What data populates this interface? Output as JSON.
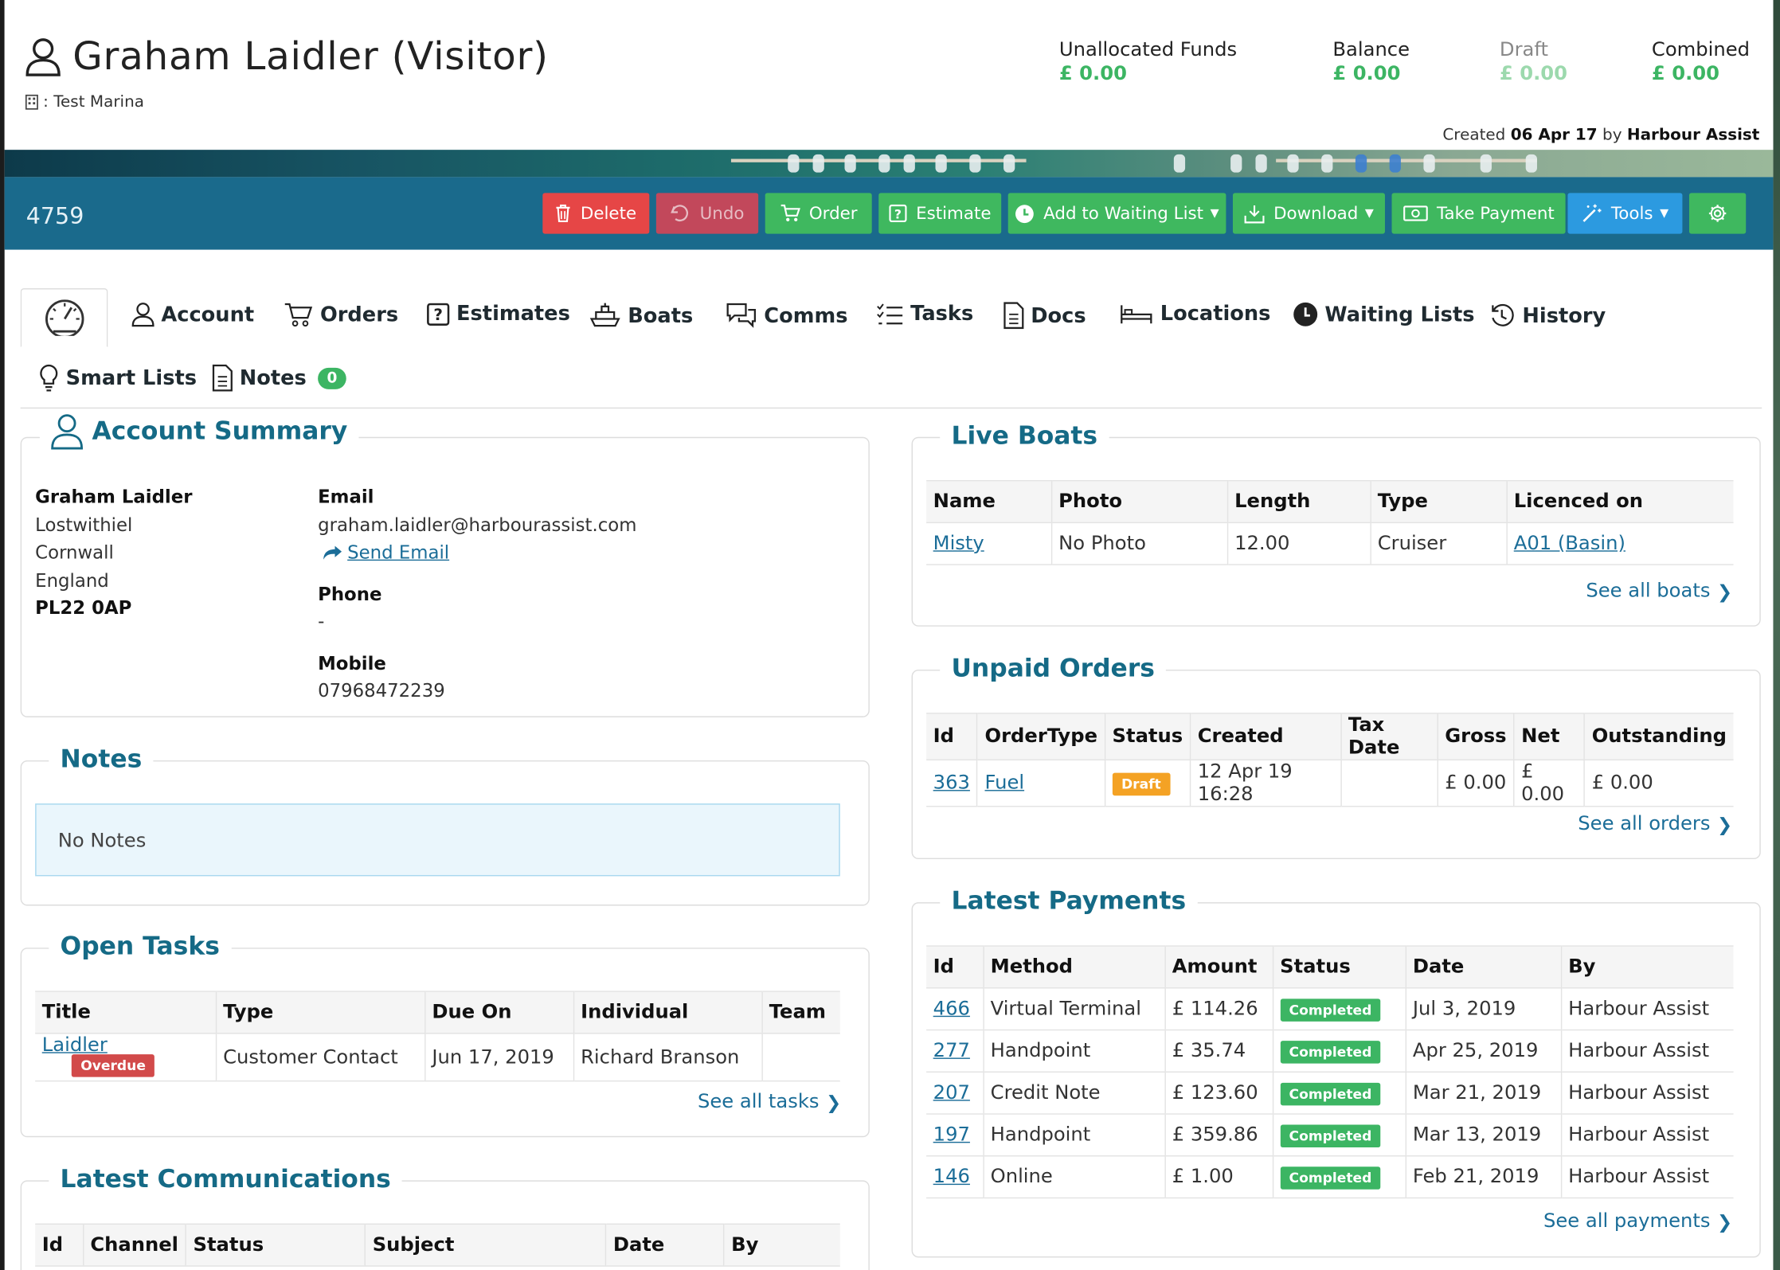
{
  "header": {
    "title": "Graham Laidler (Visitor)",
    "marina_label": ": Test Marina",
    "funds": [
      {
        "label": "Unallocated Funds",
        "value": "£ 0.00"
      },
      {
        "label": "Balance",
        "value": "£ 0.00"
      },
      {
        "label": "Draft",
        "value": "£ 0.00"
      },
      {
        "label": "Combined",
        "value": "£ 0.00"
      }
    ],
    "created_prefix": "Created",
    "created_date": "06 Apr 17",
    "created_by_prefix": "by",
    "created_by": "Harbour Assist"
  },
  "toolbar": {
    "record_id": "4759",
    "delete": "Delete",
    "undo": "Undo",
    "order": "Order",
    "estimate": "Estimate",
    "waiting_list": "Add to Waiting List",
    "download": "Download",
    "take_payment": "Take Payment",
    "tools": "Tools"
  },
  "tabs": {
    "account": "Account",
    "orders": "Orders",
    "estimates": "Estimates",
    "boats": "Boats",
    "comms": "Comms",
    "tasks": "Tasks",
    "docs": "Docs",
    "locations": "Locations",
    "waiting_lists": "Waiting Lists",
    "history": "History",
    "smart_lists": "Smart Lists",
    "notes": "Notes",
    "notes_count": "0"
  },
  "account_summary": {
    "title": "Account Summary",
    "name": "Graham Laidler",
    "address": [
      "Lostwithiel",
      "Cornwall",
      "England"
    ],
    "postcode": "PL22 0AP",
    "email_label": "Email",
    "email": "graham.laidler@harbourassist.com",
    "send_email": "Send Email",
    "phone_label": "Phone",
    "phone": "-",
    "mobile_label": "Mobile",
    "mobile": "07968472239"
  },
  "notes": {
    "title": "Notes",
    "empty": "No Notes"
  },
  "open_tasks": {
    "title": "Open Tasks",
    "columns": [
      "Title",
      "Type",
      "Due On",
      "Individual",
      "Team"
    ],
    "rows": [
      {
        "title": "Laidler",
        "badge": "Overdue",
        "type": "Customer Contact",
        "due": "Jun 17, 2019",
        "individual": "Richard Branson",
        "team": ""
      }
    ],
    "see_all": "See all tasks"
  },
  "latest_comms": {
    "title": "Latest Communications",
    "columns": [
      "Id",
      "Channel",
      "Status",
      "Subject",
      "Date",
      "By"
    ]
  },
  "live_boats": {
    "title": "Live Boats",
    "columns": [
      "Name",
      "Photo",
      "Length",
      "Type",
      "Licenced on"
    ],
    "rows": [
      {
        "name": "Misty",
        "photo": "No Photo",
        "length": "12.00",
        "type": "Cruiser",
        "licenced_on": "A01 (Basin)"
      }
    ],
    "see_all": "See all boats"
  },
  "unpaid_orders": {
    "title": "Unpaid Orders",
    "columns": [
      "Id",
      "OrderType",
      "Status",
      "Created",
      "Tax Date",
      "Gross",
      "Net",
      "Outstanding"
    ],
    "rows": [
      {
        "id": "363",
        "type": "Fuel",
        "status": "Draft",
        "created": "12 Apr 19 16:28",
        "tax_date": "",
        "gross": "£ 0.00",
        "net": "£ 0.00",
        "outstanding": "£ 0.00"
      }
    ],
    "see_all": "See all orders"
  },
  "latest_payments": {
    "title": "Latest Payments",
    "columns": [
      "Id",
      "Method",
      "Amount",
      "Status",
      "Date",
      "By"
    ],
    "rows": [
      {
        "id": "466",
        "method": "Virtual Terminal",
        "amount": "£ 114.26",
        "status": "Completed",
        "date": "Jul 3, 2019",
        "by": "Harbour Assist"
      },
      {
        "id": "277",
        "method": "Handpoint",
        "amount": "£ 35.74",
        "status": "Completed",
        "date": "Apr 25, 2019",
        "by": "Harbour Assist"
      },
      {
        "id": "207",
        "method": "Credit Note",
        "amount": "£ 123.60",
        "status": "Completed",
        "date": "Mar 21, 2019",
        "by": "Harbour Assist"
      },
      {
        "id": "197",
        "method": "Handpoint",
        "amount": "£ 359.86",
        "status": "Completed",
        "date": "Mar 13, 2019",
        "by": "Harbour Assist"
      },
      {
        "id": "146",
        "method": "Online",
        "amount": "£ 1.00",
        "status": "Completed",
        "date": "Feb 21, 2019",
        "by": "Harbour Assist"
      }
    ],
    "see_all": "See all payments"
  },
  "colors": {
    "toolbar": "#1a6a8c",
    "heading": "#156a86",
    "success": "#3cb563",
    "danger": "#e64646",
    "info": "#2c9ae0",
    "warning": "#f4a224"
  }
}
